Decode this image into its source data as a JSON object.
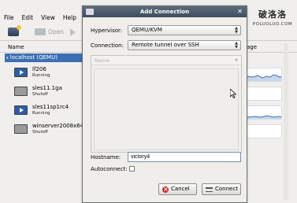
{
  "menubar": {
    "items": [
      "File",
      "Edit",
      "View",
      "Help"
    ]
  },
  "toolbar": {
    "open_label": "Open",
    "icons": [
      "new-connection-icon",
      "open-icon",
      "run-icon"
    ]
  },
  "columns": {
    "name": "Name",
    "usage_fragment": "age"
  },
  "host": {
    "label": "localhost (QEMU)"
  },
  "vms": [
    {
      "name": "lf206",
      "status": "Running",
      "icon": "running-vm-icon"
    },
    {
      "name": "sles11.1ga",
      "status": "Shutoff",
      "icon": "shutoff-vm-icon"
    },
    {
      "name": "sles11sp1rc4",
      "status": "Running",
      "icon": "running-vm-icon"
    },
    {
      "name": "winserver2008x64",
      "status": "Shutoff",
      "icon": "shutoff-vm-icon"
    }
  ],
  "watermark": {
    "cn": "破洛洛",
    "en": "POLUOLUO.COM"
  },
  "dialog": {
    "title": "Add Connection",
    "hypervisor_label": "Hypervisor:",
    "hypervisor_value": "QEMU/KVM",
    "connection_label": "Connection:",
    "connection_value": "Remote tunnel over SSH",
    "name_column_header": "Name",
    "hostname_label": "Hostname:",
    "hostname_value": "victory4",
    "autoconnect_label": "Autoconnect:",
    "autoconnect_checked": false,
    "cancel_label": "Cancel",
    "connect_label": "Connect"
  },
  "colors": {
    "selection": "#3c6eb4",
    "titlebar": "#4a5a6c",
    "dialog_bg": "#efeeeb"
  }
}
